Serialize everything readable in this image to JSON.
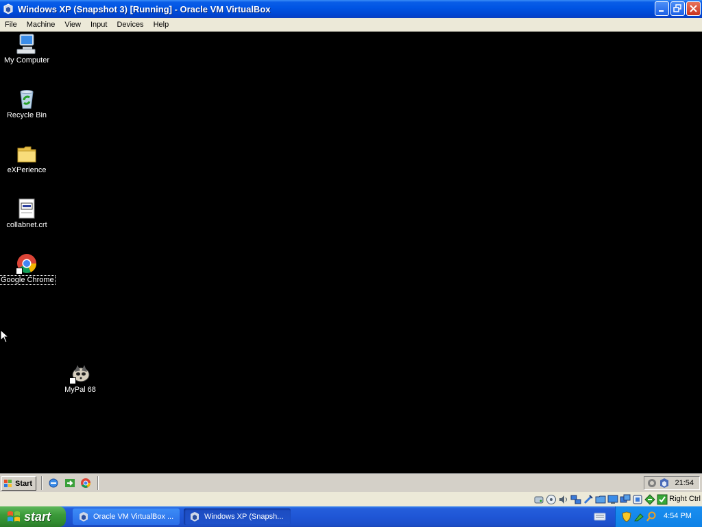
{
  "window": {
    "title": "Windows XP (Snapshot 3) [Running] - Oracle VM VirtualBox",
    "icon": "virtualbox-icon"
  },
  "menu": [
    "File",
    "Machine",
    "View",
    "Input",
    "Devices",
    "Help"
  ],
  "desktop_icons": [
    {
      "label": "My Computer",
      "icon": "computer-icon"
    },
    {
      "label": "Recycle Bin",
      "icon": "recycle-bin-icon"
    },
    {
      "label": "eXPerience",
      "icon": "folder-icon"
    },
    {
      "label": "collabnet.crt",
      "icon": "certificate-icon"
    },
    {
      "label": "Google Chrome",
      "icon": "chrome-icon"
    },
    {
      "label": "MyPal 68",
      "icon": "mypal-icon"
    }
  ],
  "guest_taskbar": {
    "start_label": "Start",
    "clock": "21:54"
  },
  "statusbar": {
    "host_key": "Right Ctrl"
  },
  "host_taskbar": {
    "start_label": "start",
    "tasks": [
      {
        "label": "Oracle VM VirtualBox ...",
        "icon": "virtualbox-icon",
        "active": false
      },
      {
        "label": "Windows XP (Snapsh...",
        "icon": "vm-window-icon",
        "active": true
      }
    ],
    "clock": "4:54 PM"
  },
  "colors": {
    "titlebar_blue": "#0054e3",
    "start_green": "#3c9b3a",
    "desktop": "#000000",
    "classic_gray": "#d4d0c8",
    "menu_beige": "#ece9d8"
  }
}
